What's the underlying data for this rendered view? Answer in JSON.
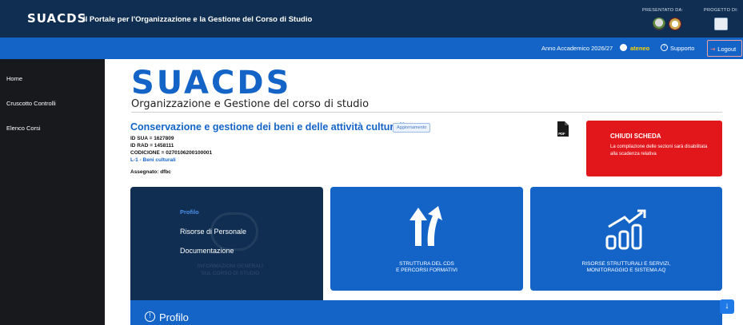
{
  "header": {
    "logo_text": "SUACDS",
    "portal_title": "Il Portale per l'Organizzazione e la Gestione del Corso di Studio",
    "presented_by": "PRESENTATO DA:",
    "project_of": "PROGETTO DI:"
  },
  "topnav": {
    "academic_year": "Anno Accademico 2026/27",
    "user": "ateneo",
    "support": "Supporto",
    "logout": "Logout"
  },
  "sidebar": {
    "items": [
      {
        "label": "Home"
      },
      {
        "label": "Cruscotto Controlli"
      },
      {
        "label": "Elenco Corsi"
      }
    ]
  },
  "main": {
    "brand": "SUACDS",
    "subtitle": "Organizzazione e Gestione del corso di studio",
    "course_title": "Conservazione e gestione dei beni e delle attività culturali",
    "update_badge": "Aggiornamento",
    "id_sua": "ID SUA = 1627809",
    "id_rad": "ID RAD = 1458111",
    "codicione": "CODICIONE = 0270106200100001",
    "class_link": "L-1 - Beni culturali",
    "assigned": "Assegnato: dfbc",
    "pdf_label": "PDF"
  },
  "close_card": {
    "title": "CHIUDI SCHEDA",
    "description": "La compilazione delle sezioni sarà disabilitata alla scadenza relativa"
  },
  "panels": {
    "menu": [
      "Profilo",
      "Risorse di Personale",
      "Documentazione"
    ],
    "watermark_line1": "INFORMAZIONI GENERALI",
    "watermark_line2": "SUL CORSO DI STUDIO",
    "structure_line1": "STRUTTURA DEL CDS",
    "structure_line2": "E PERCORSI FORMATIVI",
    "resources_line1": "RISORSE STRUTTURALI E SERVIZI,",
    "resources_line2": "MONITORAGGIO E SISTEMA AQ"
  },
  "profile_section": {
    "title": "Profilo"
  },
  "colors": {
    "navy": "#0f2e52",
    "blue": "#1464c8",
    "red": "#e2171c",
    "user_yellow": "#ffd400"
  }
}
